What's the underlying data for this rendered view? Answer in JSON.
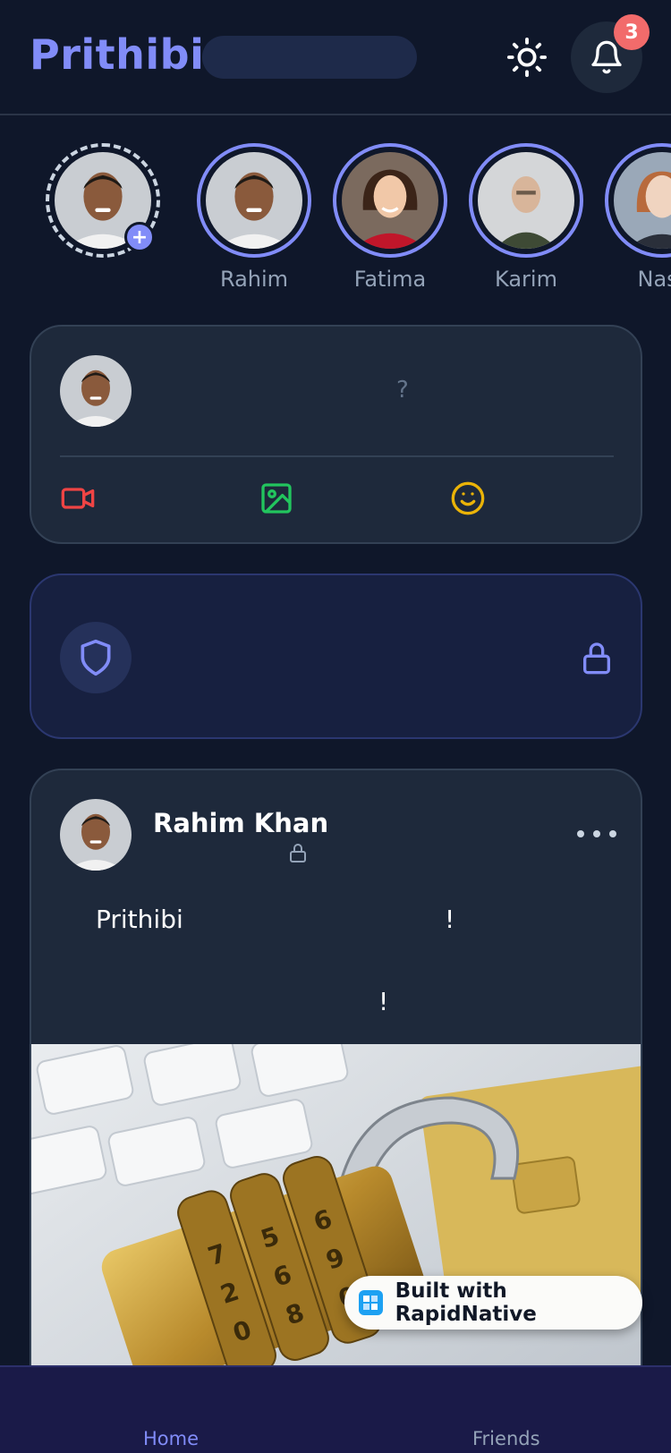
{
  "header": {
    "logo": "Prithibi",
    "notification_count": "3",
    "icons": [
      "sun-icon",
      "bell-icon"
    ]
  },
  "stories": {
    "add_icon": "+",
    "items": [
      {
        "name": "Rahim"
      },
      {
        "name": "Fatima"
      },
      {
        "name": "Karim"
      },
      {
        "name": "Nasr"
      }
    ]
  },
  "composer": {
    "prompt": "?",
    "actions": [
      "video-icon",
      "image-icon",
      "emoji-icon"
    ]
  },
  "security_card": {
    "icons": [
      "shield-icon",
      "lock-icon"
    ]
  },
  "post": {
    "author": "Rahim Khan",
    "privacy_icon": "lock-icon",
    "line1_start": "Prithibi",
    "line1_end": "!",
    "line2": "!"
  },
  "watermark": {
    "label": "Built with RapidNative"
  },
  "bottom_nav": {
    "home": "Home",
    "friends": "Friends"
  },
  "colors": {
    "background": "#0f172a",
    "card": "#1e293b",
    "accent": "#818cf8",
    "badge": "#f26b6b",
    "video": "#ef4444",
    "image": "#22c55e",
    "emoji": "#eab308"
  }
}
